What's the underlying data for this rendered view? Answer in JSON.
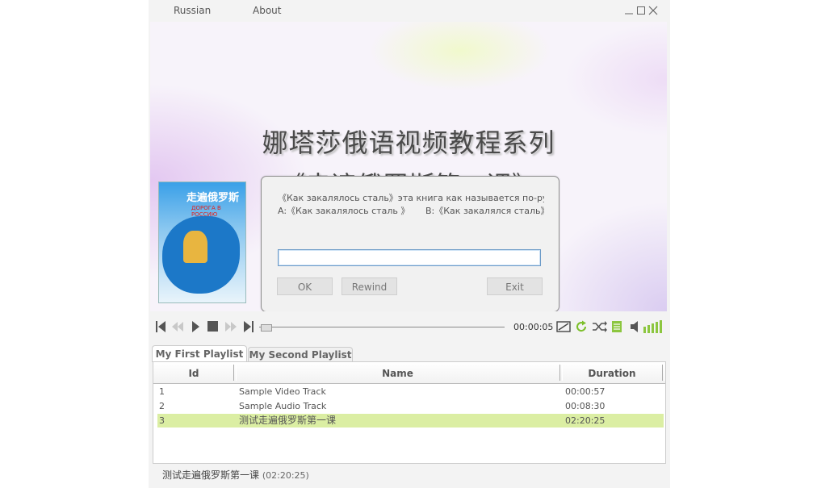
{
  "menu": {
    "items": [
      "Russian",
      "About"
    ]
  },
  "window_controls": {
    "minimize": "—",
    "maximize": "☐",
    "close": "✕"
  },
  "video": {
    "title_line1": "娜塔莎俄语视频教程系列",
    "title_line2": "《走遍俄罗斯第一课》",
    "cover": {
      "title": "走遍俄罗斯",
      "subtitle": "ДОРОГА В РОССИЮ"
    }
  },
  "dialog": {
    "question": "《Как закалялось сталь》эта книга как называется по-русски?",
    "option_a": "A:《Как закалялось сталь 》",
    "option_b": "B:《Как закалялся сталь》",
    "answer_value": "",
    "buttons": {
      "ok": "OK",
      "rewind": "Rewind",
      "exit": "Exit"
    }
  },
  "player": {
    "time": "00:00:05",
    "progress": 0.02,
    "volume_bars": 5,
    "accent_color": "#8cc63f"
  },
  "playlists": {
    "tabs": [
      "My First Playlist",
      "My Second Playlist"
    ],
    "active_tab": 0,
    "columns": [
      "Id",
      "Name",
      "Duration"
    ],
    "rows": [
      {
        "id": "1",
        "name": "Sample Video Track",
        "duration": "00:00:57"
      },
      {
        "id": "2",
        "name": "Sample Audio Track",
        "duration": "00:08:30"
      },
      {
        "id": "3",
        "name": "测试走遍俄罗斯第一课",
        "duration": "02:20:25"
      }
    ],
    "selected_row": 2
  },
  "status": {
    "track": "测试走遍俄罗斯第一课",
    "duration": "(02:20:25)"
  }
}
